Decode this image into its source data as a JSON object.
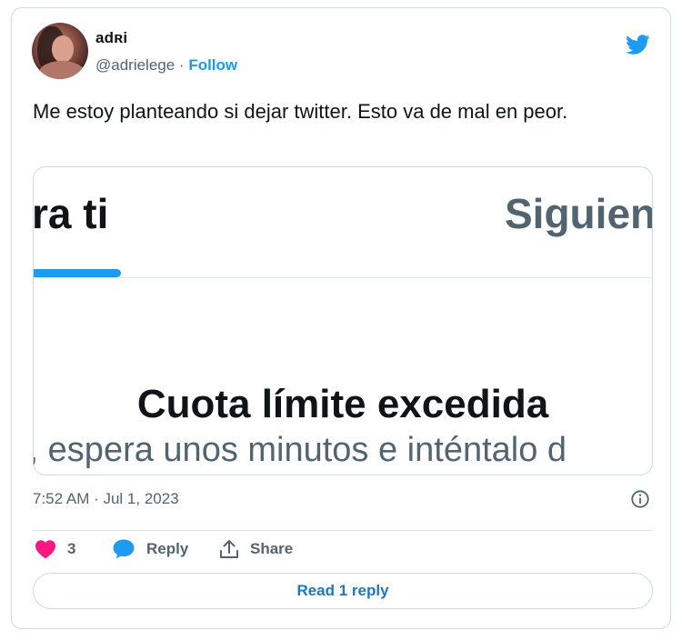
{
  "author": {
    "display_name": "adʀi",
    "handle": "@adrielege",
    "separator": " · ",
    "follow_label": "Follow"
  },
  "tweet": {
    "text": "Me estoy planteando si dejar twitter. Esto va de mal en peor."
  },
  "media": {
    "tab_left": "ra ti",
    "tab_right": "Siguien",
    "error_title": "Cuota límite excedida",
    "error_subtitle": "r, espera unos minutos e inténtalo d"
  },
  "meta": {
    "timestamp": "7:52 AM · Jul 1, 2023"
  },
  "actions": {
    "like_count": "3",
    "reply_label": "Reply",
    "share_label": "Share"
  },
  "read_replies_label": "Read 1 reply",
  "colors": {
    "brand_blue": "#1d9bf0",
    "like_pink": "#f91880",
    "text_primary": "#0f1419",
    "text_secondary": "#536471",
    "border": "#cfd9de"
  },
  "icons": [
    "twitter-bird-icon",
    "heart-icon",
    "reply-bubble-icon",
    "share-icon",
    "info-icon"
  ]
}
